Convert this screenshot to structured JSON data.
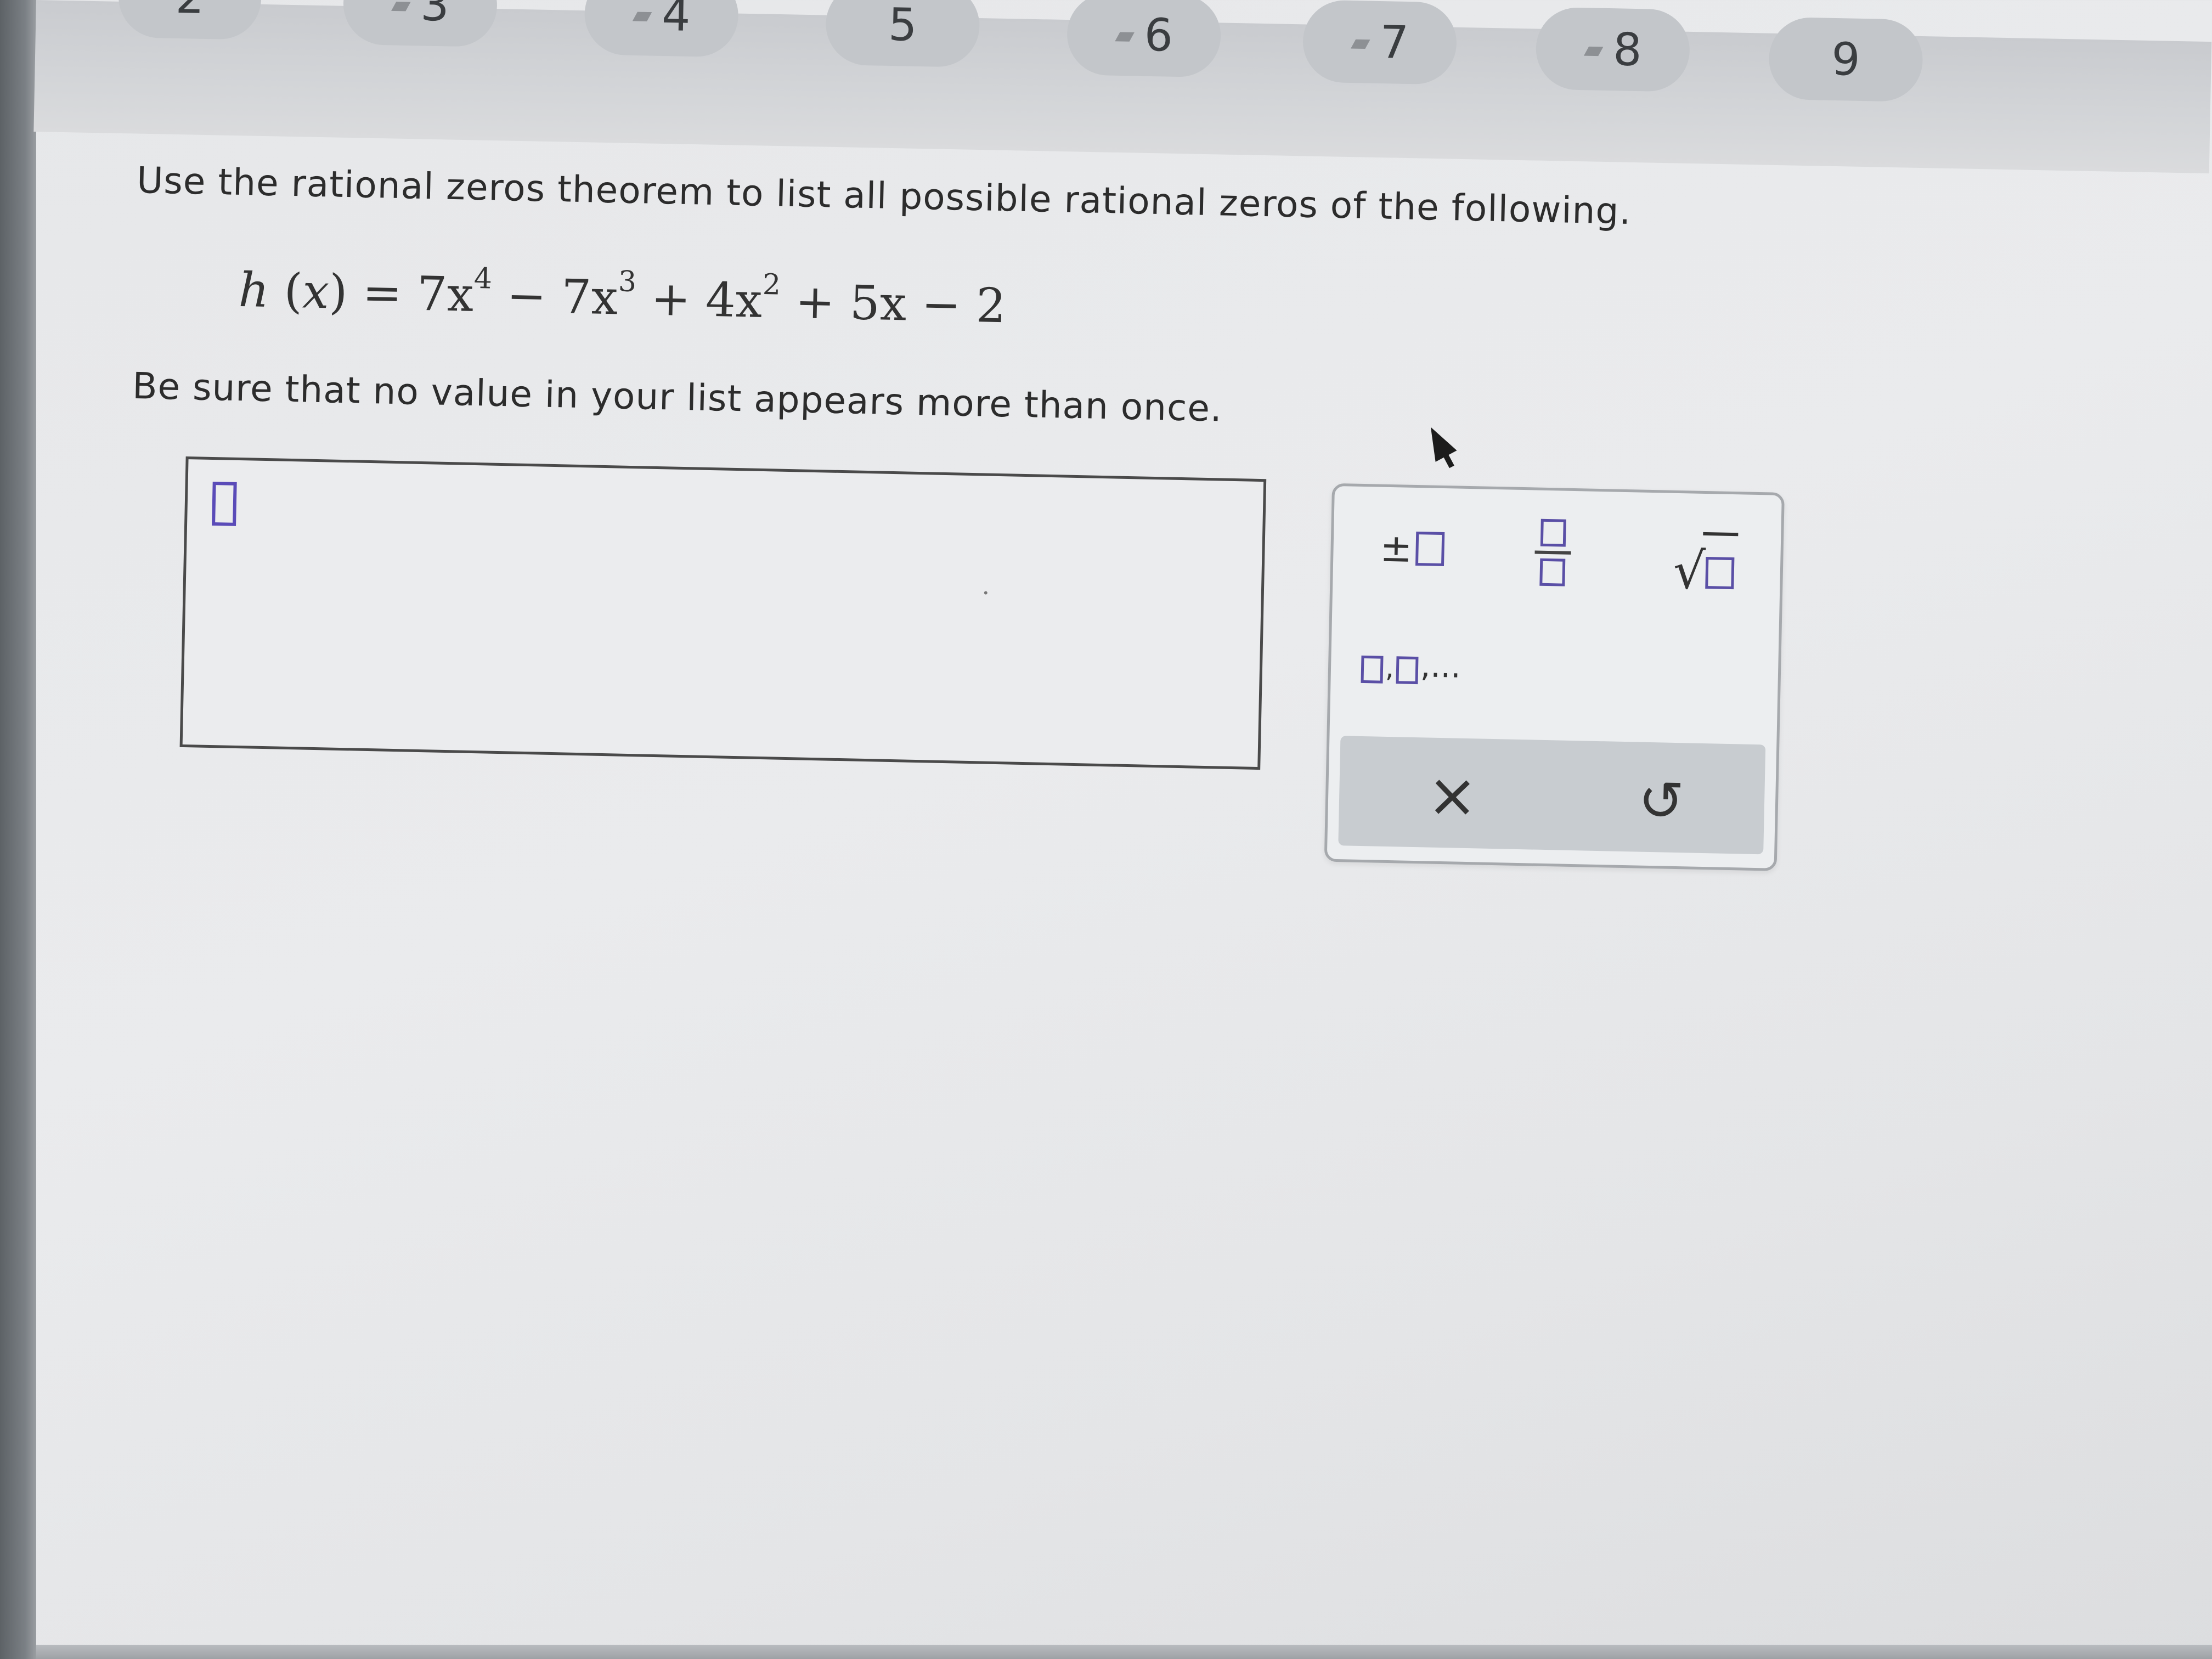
{
  "top_nav": {
    "tabs": [
      {
        "label": "2"
      },
      {
        "label": "3"
      },
      {
        "label": "4"
      },
      {
        "label": "5"
      },
      {
        "label": "6"
      },
      {
        "label": "7"
      },
      {
        "label": "8"
      },
      {
        "label": "9"
      }
    ]
  },
  "problem": {
    "prompt": "Use the rational zeros theorem to list all possible rational zeros of the following.",
    "function_name": "h",
    "variable": "x",
    "formula_parts": [
      "7x",
      "4",
      "− 7x",
      "3",
      "+ 4x",
      "2",
      "+ 5x − 2"
    ],
    "instruction": "Be sure that no value in your list appears more than once."
  },
  "keypad": {
    "plus_minus_symbol": "±",
    "sqrt_symbol": "√",
    "list_symbol": ",...",
    "clear_symbol": "×",
    "undo_symbol": "↺"
  },
  "colors": {
    "cursor": "#5a4bb8",
    "keypad_squares": "#5a4fa6"
  }
}
